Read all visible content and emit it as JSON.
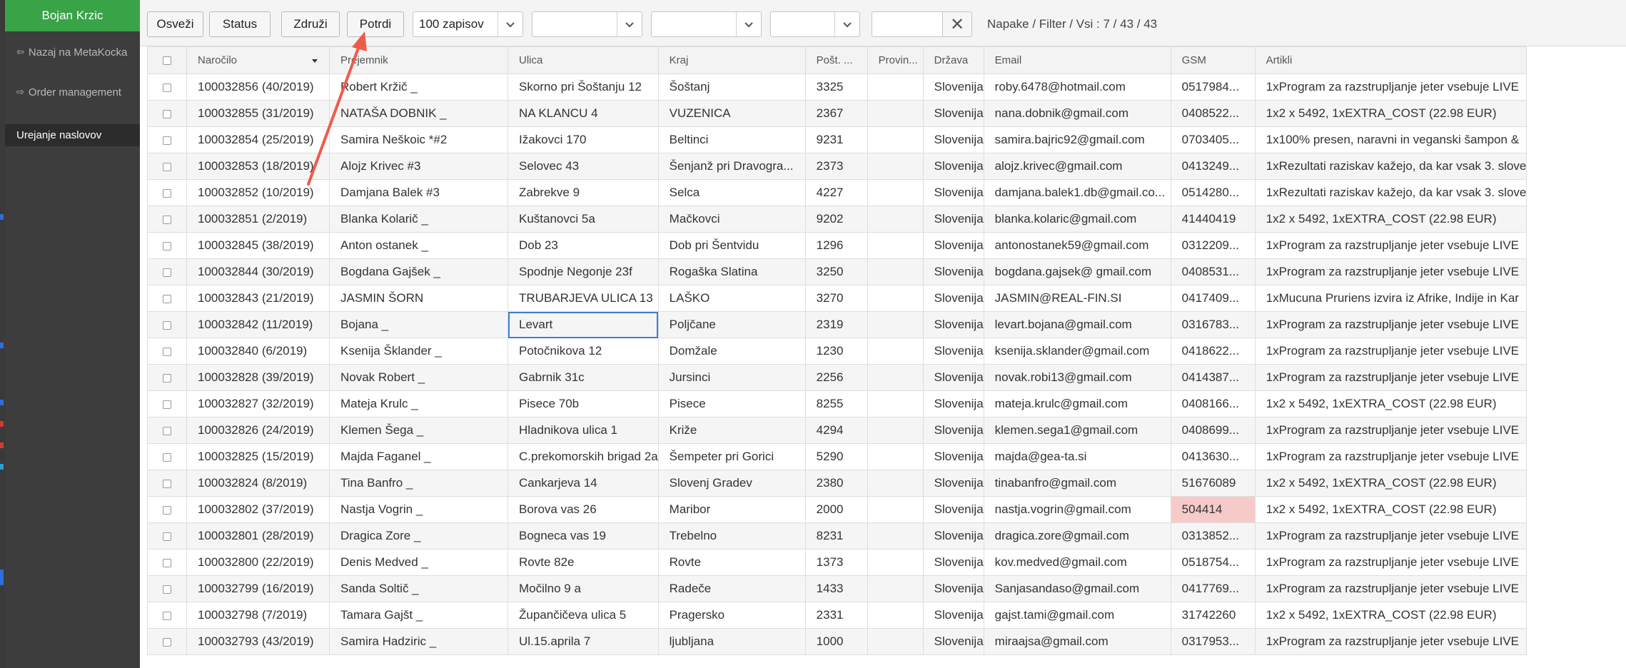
{
  "app": {
    "user_name": "Bojan Krzic",
    "nav": [
      {
        "label": "Nazaj na MetaKocka",
        "icon": "sign-out-icon"
      },
      {
        "label": "Order management",
        "icon": "sign-in-icon"
      },
      {
        "label": "Urejanje naslovov",
        "icon": ""
      }
    ],
    "accent_color": "#39a348",
    "error_color": "#f7caca"
  },
  "toolbar": {
    "refresh_label": "Osveži",
    "status_label": "Status",
    "merge_label": "Združi",
    "confirm_label": "Potrdi",
    "records_select": "100 zapisov",
    "filter1": "",
    "filter2": "",
    "filter3": "",
    "search_value": "",
    "clear_icon": "✕",
    "status_text": "Napake / Filter / Vsi : 7 / 43 / 43"
  },
  "table": {
    "columns": [
      "Naročilo",
      "Prejemnik",
      "Ulica",
      "Kraj",
      "Pošt. ...",
      "Provin...",
      "Država",
      "Email",
      "GSM",
      "Artikli"
    ],
    "rows": [
      {
        "order": "100032856 (40/2019)",
        "recipient": "Robert Kržič _",
        "street": "Skorno pri Šoštanju 12",
        "city": "Šoštanj",
        "postal": "3325",
        "province": "",
        "country": "Slovenija",
        "email": "roby.6478@hotmail.com",
        "gsm": "0517984...",
        "items": "1xProgram za razstrupljanje jeter vsebuje LIVE"
      },
      {
        "order": "100032855 (31/2019)",
        "recipient": "NATAŠA DOBNIK _",
        "street": "NA KLANCU 4",
        "city": "VUZENICA",
        "postal": "2367",
        "province": "",
        "country": "Slovenija",
        "email": "nana.dobnik@gmail.com",
        "gsm": "0408522...",
        "items": "1x2 x 5492, 1xEXTRA_COST (22.98 EUR)"
      },
      {
        "order": "100032854 (25/2019)",
        "recipient": "Samira Neškoic *#2",
        "street": "Ižakovci 170",
        "city": "Beltinci",
        "postal": "9231",
        "province": "",
        "country": "Slovenija",
        "email": "samira.bajric92@gmail.com",
        "gsm": "0703405...",
        "items": "1x100% presen, naravni in veganski šampon &"
      },
      {
        "order": "100032853 (18/2019)",
        "recipient": "Alojz Krivec #3",
        "street": "Selovec 43",
        "city": "Šenjanž pri Dravogra...",
        "postal": "2373",
        "province": "",
        "country": "Slovenija",
        "email": "alojz.krivec@gmail.com",
        "gsm": "0413249...",
        "items": "1xRezultati raziskav kažejo, da kar vsak 3. slove"
      },
      {
        "order": "100032852 (10/2019)",
        "recipient": "Damjana Balek #3",
        "street": "Zabrekve 9",
        "city": "Selca",
        "postal": "4227",
        "province": "",
        "country": "Slovenija",
        "email": "damjana.balek1.db@gmail.co...",
        "gsm": "0514280...",
        "items": "1xRezultati raziskav kažejo, da kar vsak 3. slove"
      },
      {
        "order": "100032851 (2/2019)",
        "recipient": "Blanka Kolarič _",
        "street": "Kuštanovci 5a",
        "city": "Mačkovci",
        "postal": "9202",
        "province": "",
        "country": "Slovenija",
        "email": "blanka.kolaric@gmail.com",
        "gsm": "41440419",
        "items": "1x2 x 5492, 1xEXTRA_COST (22.98 EUR)"
      },
      {
        "order": "100032845 (38/2019)",
        "recipient": "Anton ostanek _",
        "street": "Dob 23",
        "city": "Dob pri Šentvidu",
        "postal": "1296",
        "province": "",
        "country": "Slovenija",
        "email": "antonostanek59@gmail.com",
        "gsm": "0312209...",
        "items": "1xProgram za razstrupljanje jeter vsebuje LIVE"
      },
      {
        "order": "100032844 (30/2019)",
        "recipient": "Bogdana Gajšek _",
        "street": "Spodnje Negonje 23f",
        "city": "Rogaška Slatina",
        "postal": "3250",
        "province": "",
        "country": "Slovenija",
        "email": "bogdana.gajsek@ gmail.com",
        "gsm": "0408531...",
        "items": "1xProgram za razstrupljanje jeter vsebuje LIVE"
      },
      {
        "order": "100032843 (21/2019)",
        "recipient": "JASMIN ŠORN",
        "street": "TRUBARJEVA ULICA 13",
        "city": "LAŠKO",
        "postal": "3270",
        "province": "",
        "country": "Slovenija",
        "email": "JASMIN@REAL-FIN.SI",
        "gsm": "0417409...",
        "items": "1xMucuna Pruriens izvira iz Afrike, Indije in Kar"
      },
      {
        "order": "100032842 (11/2019)",
        "recipient": "Bojana _",
        "street": "Levart",
        "city": "Poljčane",
        "postal": "2319",
        "province": "",
        "country": "Slovenija",
        "email": "levart.bojana@gmail.com",
        "gsm": "0316783...",
        "items": "1xProgram za razstrupljanje jeter vsebuje LIVE"
      },
      {
        "order": "100032840 (6/2019)",
        "recipient": "Ksenija Šklander _",
        "street": "Potočnikova 12",
        "city": "Domžale",
        "postal": "1230",
        "province": "",
        "country": "Slovenija",
        "email": "ksenija.sklander@gmail.com",
        "gsm": "0418622...",
        "items": "1xProgram za razstrupljanje jeter vsebuje LIVE"
      },
      {
        "order": "100032828 (39/2019)",
        "recipient": "Novak Robert _",
        "street": "Gabrnik 31c",
        "city": "Jursinci",
        "postal": "2256",
        "province": "",
        "country": "Slovenija",
        "email": "novak.robi13@gmail.com",
        "gsm": "0414387...",
        "items": "1xProgram za razstrupljanje jeter vsebuje LIVE"
      },
      {
        "order": "100032827 (32/2019)",
        "recipient": "Mateja Krulc _",
        "street": "Pisece 70b",
        "city": "Pisece",
        "postal": "8255",
        "province": "",
        "country": "Slovenija",
        "email": "mateja.krulc@gmail.com",
        "gsm": "0408166...",
        "items": "1x2 x 5492, 1xEXTRA_COST (22.98 EUR)"
      },
      {
        "order": "100032826 (24/2019)",
        "recipient": "Klemen Šega _",
        "street": "Hladnikova ulica 1",
        "city": "Križe",
        "postal": "4294",
        "province": "",
        "country": "Slovenija",
        "email": "klemen.sega1@gmail.com",
        "gsm": "0408699...",
        "items": "1xProgram za razstrupljanje jeter vsebuje LIVE"
      },
      {
        "order": "100032825 (15/2019)",
        "recipient": "Majda Faganel _",
        "street": "C.prekomorskih brigad 2a",
        "city": "Šempeter pri Gorici",
        "postal": "5290",
        "province": "",
        "country": "Slovenija",
        "email": "majda@gea-ta.si",
        "gsm": "0413630...",
        "items": "1xProgram za razstrupljanje jeter vsebuje LIVE"
      },
      {
        "order": "100032824 (8/2019)",
        "recipient": "Tina Banfro _",
        "street": "Cankarjeva 14",
        "city": "Slovenj Gradev",
        "postal": "2380",
        "province": "",
        "country": "Slovenija",
        "email": "tinabanfro@gmail.com",
        "gsm": "51676089",
        "items": "1x2 x 5492, 1xEXTRA_COST (22.98 EUR)"
      },
      {
        "order": "100032802 (37/2019)",
        "recipient": "Nastja Vogrin _",
        "street": "Borova vas 26",
        "city": "Maribor",
        "postal": "2000",
        "province": "",
        "country": "Slovenija",
        "email": "nastja.vogrin@gmail.com",
        "gsm": "504414",
        "items": "1x2 x 5492, 1xEXTRA_COST (22.98 EUR)"
      },
      {
        "order": "100032801 (28/2019)",
        "recipient": "Dragica Zore _",
        "street": "Bogneca vas 19",
        "city": "Trebelno",
        "postal": "8231",
        "province": "",
        "country": "Slovenija",
        "email": "dragica.zore@gmail.com",
        "gsm": "0313852...",
        "items": "1xProgram za razstrupljanje jeter vsebuje LIVE"
      },
      {
        "order": "100032800 (22/2019)",
        "recipient": "Denis Medved _",
        "street": "Rovte 82e",
        "city": "Rovte",
        "postal": "1373",
        "province": "",
        "country": "Slovenija",
        "email": "kov.medved@gmail.com",
        "gsm": "0518754...",
        "items": "1xProgram za razstrupljanje jeter vsebuje LIVE"
      },
      {
        "order": "100032799 (16/2019)",
        "recipient": "Sanda Soltič _",
        "street": "Močilno 9 a",
        "city": "Radeče",
        "postal": "1433",
        "province": "",
        "country": "Slovenija",
        "email": "Sanjasandaso@gmail.com",
        "gsm": "0417769...",
        "items": "1xProgram za razstrupljanje jeter vsebuje LIVE"
      },
      {
        "order": "100032798 (7/2019)",
        "recipient": "Tamara Gajšt _",
        "street": "Župančičeva ulica 5",
        "city": "Pragersko",
        "postal": "2331",
        "province": "",
        "country": "Slovenija",
        "email": "gajst.tami@gmail.com",
        "gsm": "31742260",
        "items": "1x2 x 5492, 1xEXTRA_COST (22.98 EUR)"
      },
      {
        "order": "100032793 (43/2019)",
        "recipient": "Samira Hadziric _",
        "street": "Ul.15.aprila 7",
        "city": "ljubljana",
        "postal": "1000",
        "province": "",
        "country": "Slovenija",
        "email": "miraajsa@gmail.com",
        "gsm": "0317953...",
        "items": "1xProgram za razstrupljanje jeter vsebuje LIVE"
      }
    ],
    "error_cells": [
      {
        "row": 7,
        "field": "email"
      },
      {
        "row": 9,
        "field": "street"
      },
      {
        "row": 16,
        "field": "gsm"
      }
    ],
    "selected_cell": {
      "row": 9,
      "field": "street"
    }
  }
}
